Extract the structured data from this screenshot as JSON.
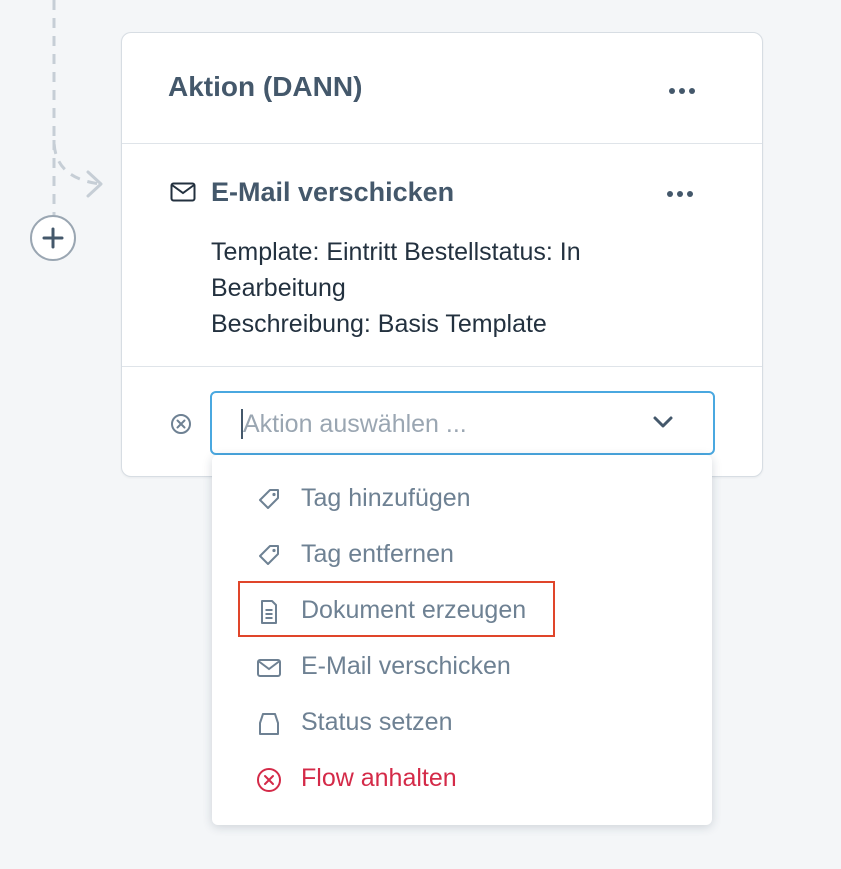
{
  "card": {
    "title": "Aktion (DANN)"
  },
  "action": {
    "title": "E-Mail verschicken",
    "description_lines": [
      "Template: Eintritt Bestellstatus: In",
      "Bearbeitung",
      "Beschreibung: Basis Template"
    ]
  },
  "select": {
    "placeholder": "Aktion auswählen ..."
  },
  "menu": {
    "items": [
      {
        "label": "Tag hinzufügen",
        "icon": "tag-icon"
      },
      {
        "label": "Tag entfernen",
        "icon": "tag-icon"
      },
      {
        "label": "Dokument erzeugen",
        "icon": "document-icon",
        "highlighted": true
      },
      {
        "label": "E-Mail verschicken",
        "icon": "mail-icon"
      },
      {
        "label": "Status setzen",
        "icon": "status-icon"
      },
      {
        "label": "Flow anhalten",
        "icon": "stop-icon",
        "danger": true
      }
    ]
  },
  "colors": {
    "text_dark": "#23313f",
    "heading": "#44586b",
    "muted": "#6e8193",
    "focus": "#4aa8e0",
    "danger": "#d42a48",
    "highlight": "#e0452a"
  }
}
